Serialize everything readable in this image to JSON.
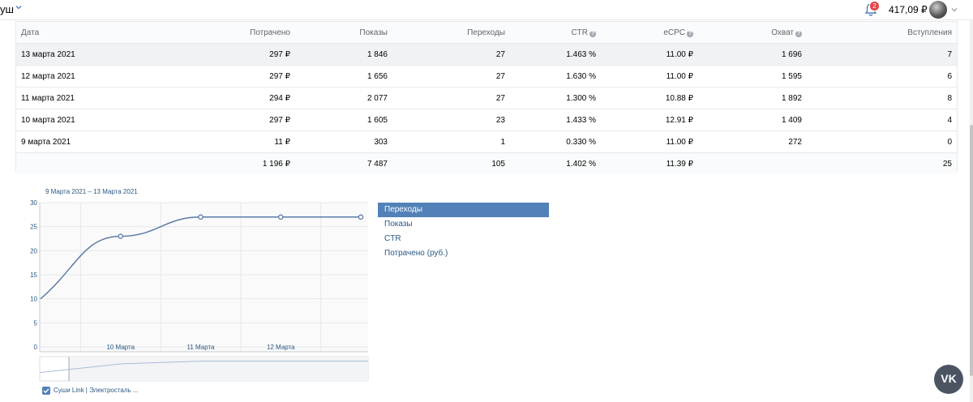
{
  "header": {
    "title": "уш",
    "balance": "417,09 ₽",
    "notifications_count": "2"
  },
  "table": {
    "headers": {
      "date": "Дата",
      "spent": "Потрачено",
      "impressions": "Показы",
      "clicks": "Переходы",
      "ctr": "CTR",
      "ecpc": "eCPC",
      "reach": "Охват",
      "joins": "Вступления"
    },
    "rows": [
      {
        "date": "13 марта 2021",
        "spent": "297 ₽",
        "impressions": "1 846",
        "clicks": "27",
        "ctr": "1.463 %",
        "ecpc": "11.00 ₽",
        "reach": "1 696",
        "joins": "7"
      },
      {
        "date": "12 марта 2021",
        "spent": "297 ₽",
        "impressions": "1 656",
        "clicks": "27",
        "ctr": "1.630 %",
        "ecpc": "11.00 ₽",
        "reach": "1 595",
        "joins": "6"
      },
      {
        "date": "11 марта 2021",
        "spent": "294 ₽",
        "impressions": "2 077",
        "clicks": "27",
        "ctr": "1.300 %",
        "ecpc": "10.88 ₽",
        "reach": "1 892",
        "joins": "8"
      },
      {
        "date": "10 марта 2021",
        "spent": "297 ₽",
        "impressions": "1 605",
        "clicks": "23",
        "ctr": "1.433 %",
        "ecpc": "12.91 ₽",
        "reach": "1 409",
        "joins": "4"
      },
      {
        "date": "9 марта 2021",
        "spent": "11 ₽",
        "impressions": "303",
        "clicks": "1",
        "ctr": "0.330 %",
        "ecpc": "11.00 ₽",
        "reach": "272",
        "joins": "0"
      }
    ],
    "total": {
      "date": "",
      "spent": "1 196 ₽",
      "impressions": "7 487",
      "clicks": "105",
      "ctr": "1.402 %",
      "ecpc": "11.39 ₽",
      "reach": "",
      "joins": "25"
    }
  },
  "chart": {
    "range_label": "9 Марта 2021 – 13 Марта 2021",
    "legend": [
      "Переходы",
      "Показы",
      "CTR",
      "Потрачено (руб.)"
    ],
    "active_legend": 0,
    "series_checkbox_label": "Суши Link | Электросталь ...",
    "colors": {
      "line": "#5b7ca6",
      "grid": "#e7e8ec",
      "accent": "#5181b8"
    }
  },
  "chart_data": {
    "type": "line",
    "x": [
      "9 Марта",
      "10 Марта",
      "11 Марта",
      "12 Марта",
      "13 Марта"
    ],
    "x_tick_labels": [
      "10 Марта",
      "11 Марта",
      "12 Марта"
    ],
    "series": [
      {
        "name": "Переходы",
        "values": [
          10,
          23,
          27,
          27,
          27
        ]
      }
    ],
    "ylim": [
      0,
      30
    ],
    "yticks": [
      0,
      5,
      10,
      15,
      20,
      25,
      30
    ],
    "grid": true
  }
}
